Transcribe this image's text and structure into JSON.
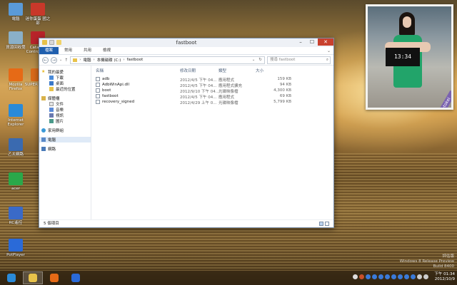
{
  "desktop": {
    "icons": [
      {
        "label": "電腦",
        "icon": "computer-icon",
        "color": "#5a9ad8"
      },
      {
        "label": "迷你蛋蛋 國之部",
        "icon": "app-icon",
        "color": "#c8382a"
      },
      {
        "label": "資源回收筒",
        "icon": "recycle-bin-icon",
        "color": "#8ab0c8"
      },
      {
        "label": "Catalyst Control 監控",
        "icon": "catalyst-icon",
        "color": "#b8242a"
      },
      {
        "label": "Mozilla Firefox",
        "icon": "firefox-icon",
        "color": "#e66a16"
      },
      {
        "label": "SUPER C 百萬",
        "icon": "super-c-icon",
        "color": "#d86a1a"
      },
      {
        "label": "Internet Explorer",
        "icon": "ie-icon",
        "color": "#2a8ad8"
      },
      {
        "label": "乙太網路",
        "icon": "network-icon",
        "color": "#3a6ab0"
      },
      {
        "label": "acer",
        "icon": "acer-icon",
        "color": "#2aa84a"
      },
      {
        "label": "RC遙控",
        "icon": "rc-icon",
        "color": "#3a6ac8"
      },
      {
        "label": "PotPlayer",
        "icon": "potplayer-icon",
        "color": "#2a6ad8"
      }
    ]
  },
  "window": {
    "title": "fastboot",
    "ribbon_tabs": [
      "檔案",
      "常用",
      "共用",
      "檢視"
    ],
    "address": {
      "crumbs": [
        "電腦",
        "本機磁碟 (C:)",
        "fastboot"
      ]
    },
    "search_placeholder": "搜尋 fastboot",
    "nav": {
      "favorites": "我的最愛",
      "favorites_items": [
        "下載",
        "桌面",
        "最近的位置"
      ],
      "libraries": "媒體櫃",
      "libraries_items": [
        "文件",
        "音樂",
        "視訊",
        "圖片"
      ],
      "homegroup": "家用群組",
      "computer": "電腦",
      "network": "網路"
    },
    "columns": {
      "name": "名稱",
      "date": "修改日期",
      "type": "類型",
      "size": "大小"
    },
    "files": [
      {
        "name": "adb",
        "date": "2012/4/5 下午 04...",
        "type": "應用程式",
        "size": "159 KB"
      },
      {
        "name": "AdbWinApi.dll",
        "date": "2012/4/5 下午 04...",
        "type": "應用程式擴充",
        "size": "94 KB"
      },
      {
        "name": "boot",
        "date": "2012/9/10 下午 04...",
        "type": "光碟映像檔",
        "size": "4,300 KB"
      },
      {
        "name": "fastboot",
        "date": "2012/4/5 下午 04...",
        "type": "應用程式",
        "size": "69 KB"
      },
      {
        "name": "recovery_signed",
        "date": "2012/4/29 上午 0...",
        "type": "光碟映像檔",
        "size": "5,799 KB"
      }
    ],
    "status": "5 個項目"
  },
  "gadget": {
    "clock_text": "13:34",
    "label": "bijin-tokei"
  },
  "taskbar": {
    "apps": [
      {
        "icon": "ie-icon",
        "color": "#2a8ad8"
      },
      {
        "icon": "file-explorer-icon",
        "color": "#e8c24a"
      },
      {
        "icon": "firefox-icon",
        "color": "#e66a16"
      },
      {
        "icon": "potplayer-icon",
        "color": "#2a6ad8"
      }
    ],
    "time": "下午 01:34",
    "date": "2012/10/9"
  },
  "watermark": {
    "line1": "評估版",
    "line2": "Windows 8 Release Preview",
    "line3": "Build 8400"
  },
  "colors": {
    "accent": "#1f5fae",
    "close": "#c8402e",
    "selection": "#dfeaf7"
  }
}
